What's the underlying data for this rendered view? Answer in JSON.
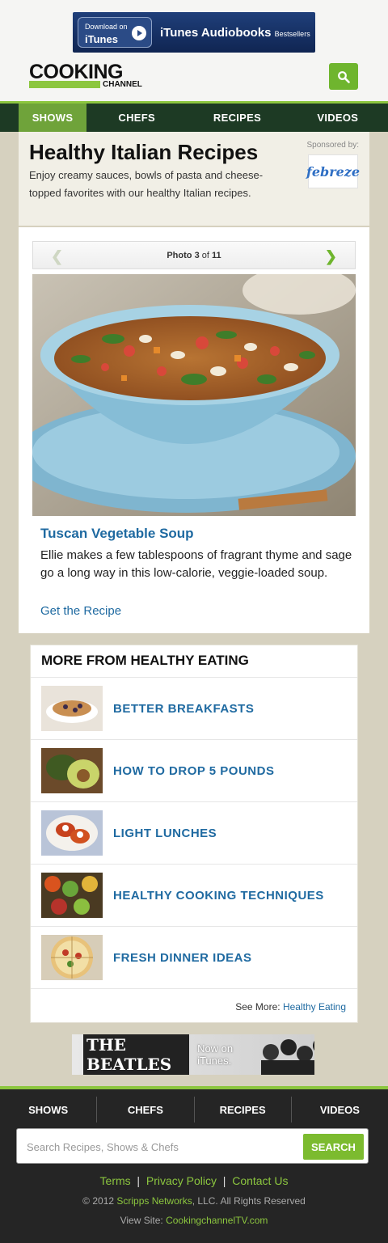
{
  "ad_top": {
    "badge_line1": "Download on",
    "badge_line2": "iTunes",
    "headline": "iTunes Audiobooks",
    "tag": "Bestsellers"
  },
  "logo": {
    "word": "COOKING",
    "sub": "CHANNEL"
  },
  "nav": {
    "items": [
      "SHOWS",
      "CHEFS",
      "RECIPES",
      "VIDEOS"
    ],
    "active": "SHOWS"
  },
  "header": {
    "title": "Healthy Italian Recipes",
    "description": "Enjoy creamy sauces, bowls of pasta and cheese-topped favorites with our healthy Italian recipes.",
    "sponsored_label": "Sponsored by:",
    "sponsor": "febreze"
  },
  "gallery": {
    "pager_prefix": "Photo",
    "current": "3",
    "of_label": "of",
    "total": "11"
  },
  "recipe": {
    "title": "Tuscan Vegetable Soup",
    "description": "Ellie makes a few tablespoons of fragrant thyme and sage go a long way in this low-calorie, veggie-loaded soup.",
    "link": "Get the Recipe"
  },
  "more": {
    "heading": "MORE FROM HEALTHY EATING",
    "items": [
      {
        "label": "BETTER BREAKFASTS"
      },
      {
        "label": "HOW TO DROP 5 POUNDS"
      },
      {
        "label": "LIGHT LUNCHES"
      },
      {
        "label": "HEALTHY COOKING TECHNIQUES"
      },
      {
        "label": "FRESH DINNER IDEAS"
      }
    ],
    "see_more_label": "See More:",
    "see_more_link": "Healthy Eating"
  },
  "ad_bottom": {
    "band": "THE BEATLES",
    "text": "Now on  iTunes."
  },
  "footer": {
    "nav": [
      "SHOWS",
      "CHEFS",
      "RECIPES",
      "VIDEOS"
    ],
    "search_placeholder": "Search Recipes, Shows & Chefs",
    "search_button": "SEARCH",
    "links": [
      "Terms",
      "Privacy Policy",
      "Contact Us"
    ],
    "copyright_prefix": "© 2012",
    "copyright_link": "Scripps Networks",
    "copyright_suffix": ", LLC. All Rights Reserved",
    "view_site_label": "View Site:",
    "view_site_link": "CookingchannelTV.com"
  },
  "colors": {
    "brand_green": "#8cc63f",
    "link_blue": "#1f6aa1",
    "nav_dark": "#1d3a24"
  }
}
